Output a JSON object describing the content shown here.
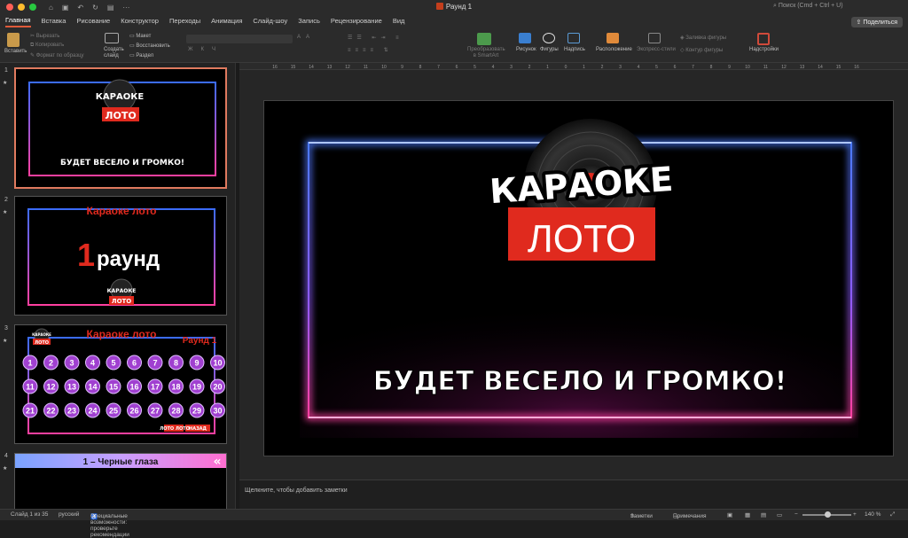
{
  "window": {
    "title": "Раунд 1",
    "search_placeholder": "Поиск (Cmd + Ctrl + U)",
    "share_label": "Поделиться"
  },
  "tabs": [
    "Главная",
    "Вставка",
    "Рисование",
    "Конструктор",
    "Переходы",
    "Анимация",
    "Слайд-шоу",
    "Запись",
    "Рецензирование",
    "Вид"
  ],
  "ribbon": {
    "paste": "Вставить",
    "cut": "Вырезать",
    "copy": "Копировать",
    "format_painter": "Формат по образцу",
    "new_slide": "Создать слайд",
    "layout": "Макет",
    "reset": "Восстановить",
    "section": "Раздел",
    "convert_smartart": "Преобразовать в SmartArt",
    "picture": "Рисунок",
    "shapes": "Фигуры",
    "textbox": "Надпись",
    "arrange": "Расположение",
    "quick_styles": "Экспресс-стили",
    "shape_fill": "Заливка фигуры",
    "shape_outline": "Контур фигуры",
    "addins": "Надстройки"
  },
  "ruler_labels": [
    "16",
    "15",
    "14",
    "13",
    "12",
    "11",
    "10",
    "9",
    "8",
    "7",
    "6",
    "5",
    "4",
    "3",
    "2",
    "1",
    "0",
    "1",
    "2",
    "3",
    "4",
    "5",
    "6",
    "7",
    "8",
    "9",
    "10",
    "11",
    "12",
    "13",
    "14",
    "15",
    "16"
  ],
  "slides": [
    {
      "num": "1",
      "caption": "БУДЕТ ВЕСЕЛО И ГРОМКО!",
      "logo_top": "КАРАОКЕ",
      "logo_bottom": "ЛОТО"
    },
    {
      "num": "2",
      "title": "Караоке лото",
      "round_num": "1",
      "round_word": "раунд",
      "logo_top": "КАРАОКЕ",
      "logo_bottom": "ЛОТО"
    },
    {
      "num": "3",
      "title": "Караоке лото",
      "round_label": "Раунд 1",
      "numbers": [
        "1",
        "2",
        "3",
        "4",
        "5",
        "6",
        "7",
        "8",
        "9",
        "10",
        "11",
        "12",
        "13",
        "14",
        "15",
        "16",
        "17",
        "18",
        "19",
        "20",
        "21",
        "22",
        "23",
        "24",
        "25",
        "26",
        "27",
        "28",
        "29",
        "30"
      ],
      "logo_top": "КАРАОКЕ",
      "logo_bottom": "ЛОТО",
      "back_label": "НАЗАД",
      "footer": "ЛОТО ЛОТО"
    },
    {
      "num": "4",
      "title": "1 – Черные глаза",
      "nav_icon": "«"
    }
  ],
  "main_slide": {
    "logo_top": "КАРАОКЕ",
    "logo_bottom": "ЛОТО",
    "caption": "БУДЕТ ВЕСЕЛО И ГРОМКО!"
  },
  "notes_placeholder": "Щелкните, чтобы добавить заметки",
  "status": {
    "slide_count": "Слайд 1 из 35",
    "language": "русский",
    "accessibility": "Специальные возможности: проверьте рекомендации",
    "notes": "Заметки",
    "comments": "Примечания",
    "zoom": "140 %"
  },
  "colors": {
    "accent": "#e05a3a",
    "neon_blue": "#3b6cff",
    "neon_pink": "#ff3fa0",
    "logo_red": "#e02a1e",
    "ball_purple": "#a040d0"
  }
}
